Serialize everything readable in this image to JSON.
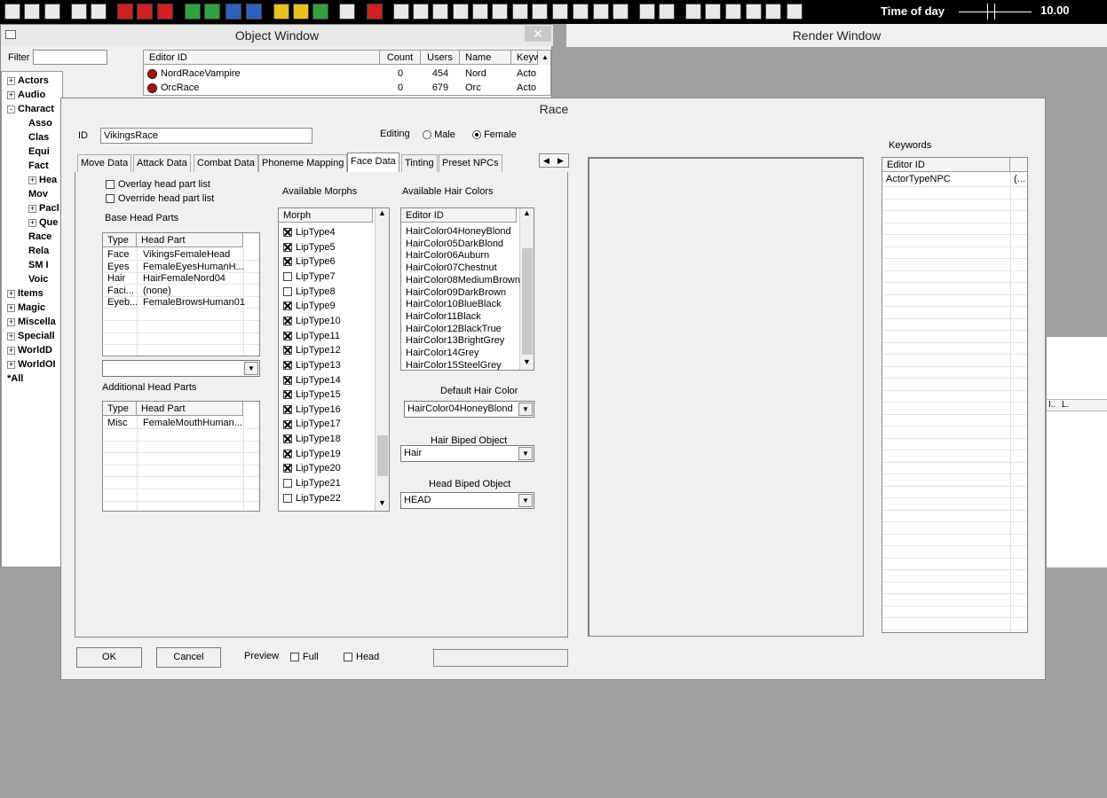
{
  "toolbar": {
    "time_of_day_label": "Time of day",
    "time_of_day_value": "10.00",
    "time_of_day_fraction": 0.44,
    "icons": [
      "open-icon",
      "save-icon",
      "preferences-icon",
      "undo-icon",
      "redo-icon",
      "marker-icon",
      "landscape-icon",
      "navmesh-icon",
      "sky-icon",
      "water-icon",
      "havok-icon",
      "fog-icon",
      "light-icon",
      "particles-icon",
      "grass-icon",
      "lasso-icon",
      "terrain-icon",
      "box-icon",
      "sphere-icon",
      "circle-icon",
      "o-icon",
      "cube-icon",
      "bounds-icon",
      "portal-icon",
      "p-icon",
      "roombound-icon",
      "occlusion-icon",
      "navmesh2-icon",
      "collision-icon",
      "arrow-icon",
      "box2-icon",
      "c-icon",
      "cube2-icon",
      "sphere2-icon",
      "w-icon",
      "wb-icon",
      "gear-icon"
    ]
  },
  "object_window": {
    "title": "Object Window",
    "filter_label": "Filter",
    "columns": [
      "Editor ID",
      "Count",
      "Users",
      "Name",
      "Keyw"
    ],
    "rows": [
      {
        "editor_id": "NordRaceVampire",
        "count": "0",
        "users": "454",
        "name": "Nord",
        "keyw": "Acto"
      },
      {
        "editor_id": "OrcRace",
        "count": "0",
        "users": "679",
        "name": "Orc",
        "keyw": "Acto"
      }
    ],
    "tree": [
      {
        "label": "Actors",
        "level": 0,
        "exp": "+"
      },
      {
        "label": "Audio",
        "level": 0,
        "exp": "+"
      },
      {
        "label": "Charact",
        "level": 0,
        "exp": "-"
      },
      {
        "label": "Asso",
        "level": 1,
        "exp": ""
      },
      {
        "label": "Clas",
        "level": 1,
        "exp": ""
      },
      {
        "label": "Equi",
        "level": 1,
        "exp": ""
      },
      {
        "label": "Fact",
        "level": 1,
        "exp": ""
      },
      {
        "label": "Hea",
        "level": 1,
        "exp": "+"
      },
      {
        "label": "Mov",
        "level": 1,
        "exp": ""
      },
      {
        "label": "Pacl",
        "level": 1,
        "exp": "+"
      },
      {
        "label": "Que",
        "level": 1,
        "exp": "+"
      },
      {
        "label": "Race",
        "level": 1,
        "exp": ""
      },
      {
        "label": "Rela",
        "level": 1,
        "exp": ""
      },
      {
        "label": "SM I",
        "level": 1,
        "exp": ""
      },
      {
        "label": "Voic",
        "level": 1,
        "exp": ""
      },
      {
        "label": "Items",
        "level": 0,
        "exp": "+"
      },
      {
        "label": "Magic",
        "level": 0,
        "exp": "+"
      },
      {
        "label": "Miscella",
        "level": 0,
        "exp": "+"
      },
      {
        "label": "Speciall",
        "level": 0,
        "exp": "+"
      },
      {
        "label": "WorldD",
        "level": 0,
        "exp": "+"
      },
      {
        "label": "WorldOI",
        "level": 0,
        "exp": "+"
      },
      {
        "label": "*All",
        "level": 0,
        "exp": ""
      }
    ]
  },
  "render_window": {
    "title": "Render Window",
    "mini_columns": [
      "I..",
      "L."
    ]
  },
  "race_dialog": {
    "title": "Race",
    "id_label": "ID",
    "id_value": "VikingsRace",
    "editing_label": "Editing",
    "male_label": "Male",
    "female_label": "Female",
    "selected_gender": "Female",
    "tabs": [
      "Move Data",
      "Attack Data",
      "Combat Data",
      "Phoneme Mapping",
      "Face Data",
      "Tinting",
      "Preset NPCs"
    ],
    "active_tab": "Face Data",
    "overlay_label": "Overlay head part list",
    "override_label": "Override head part list",
    "base_head_parts_label": "Base Head Parts",
    "head_parts_columns": [
      "Type",
      "Head Part"
    ],
    "base_head_parts": [
      {
        "type": "Face",
        "part": "VikingsFemaleHead"
      },
      {
        "type": "Eyes",
        "part": "FemaleEyesHumanH..."
      },
      {
        "type": "Hair",
        "part": "HairFemaleNord04"
      },
      {
        "type": "Faci...",
        "part": "(none)"
      },
      {
        "type": "Eyeb...",
        "part": "FemaleBrowsHuman01"
      }
    ],
    "additional_head_parts_label": "Additional Head Parts",
    "additional_head_parts": [
      {
        "type": "Misc",
        "part": "FemaleMouthHuman..."
      }
    ],
    "available_morphs_label": "Available Morphs",
    "morph_column": "Morph",
    "morphs": [
      {
        "name": "LipType4",
        "checked": true
      },
      {
        "name": "LipType5",
        "checked": true
      },
      {
        "name": "LipType6",
        "checked": true
      },
      {
        "name": "LipType7",
        "checked": false
      },
      {
        "name": "LipType8",
        "checked": false
      },
      {
        "name": "LipType9",
        "checked": true
      },
      {
        "name": "LipType10",
        "checked": true
      },
      {
        "name": "LipType11",
        "checked": true
      },
      {
        "name": "LipType12",
        "checked": true
      },
      {
        "name": "LipType13",
        "checked": true
      },
      {
        "name": "LipType14",
        "checked": true
      },
      {
        "name": "LipType15",
        "checked": true
      },
      {
        "name": "LipType16",
        "checked": true
      },
      {
        "name": "LipType17",
        "checked": true
      },
      {
        "name": "LipType18",
        "checked": true
      },
      {
        "name": "LipType19",
        "checked": true
      },
      {
        "name": "LipType20",
        "checked": true
      },
      {
        "name": "LipType21",
        "checked": false
      },
      {
        "name": "LipType22",
        "checked": false
      }
    ],
    "available_hair_colors_label": "Available Hair Colors",
    "hair_column": "Editor ID",
    "hair_colors": [
      "HairColor04HoneyBlond",
      "HairColor05DarkBlond",
      "HairColor06Auburn",
      "HairColor07Chestnut",
      "HairColor08MediumBrown",
      "HairColor09DarkBrown",
      "HairColor10BlueBlack",
      "HairColor11Black",
      "HairColor12BlackTrue",
      "HairColor13BrightGrey",
      "HairColor14Grey",
      "HairColor15SteelGrey"
    ],
    "default_hair_color_label": "Default Hair Color",
    "default_hair_color_value": "HairColor04HoneyBlond",
    "hair_biped_label": "Hair Biped Object",
    "hair_biped_value": "Hair",
    "head_biped_label": "Head Biped Object",
    "head_biped_value": "HEAD",
    "ok_label": "OK",
    "cancel_label": "Cancel",
    "preview_label": "Preview",
    "full_label": "Full",
    "head_label": "Head",
    "keywords_label": "Keywords",
    "keywords_column": "Editor ID",
    "keywords": [
      {
        "id": "ActorTypeNPC",
        "extra": "(..."
      }
    ]
  }
}
